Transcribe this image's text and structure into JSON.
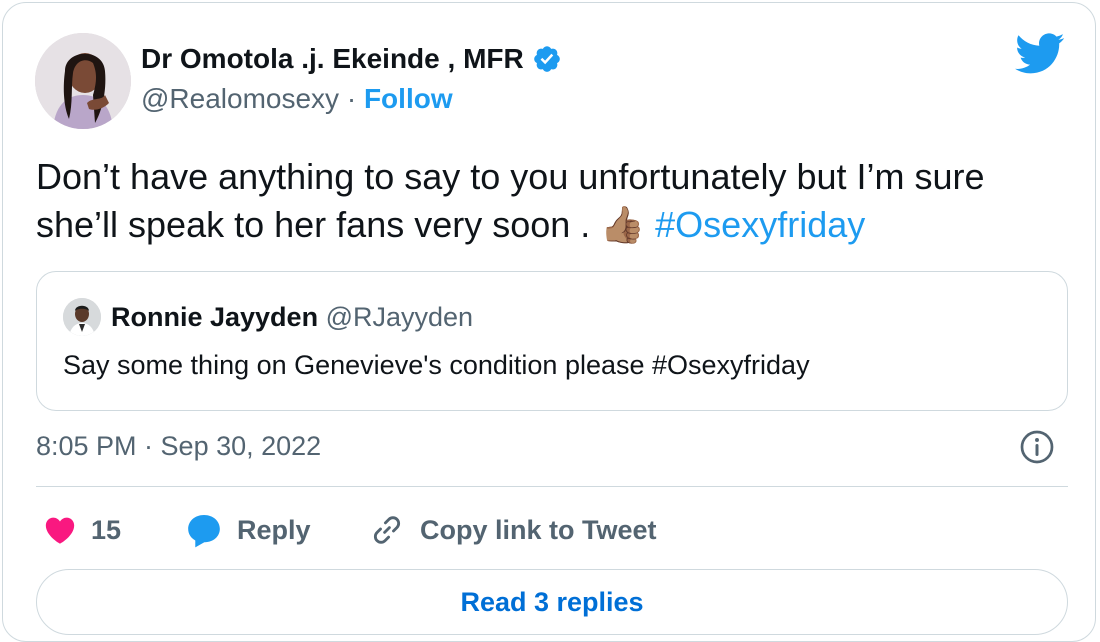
{
  "author": {
    "name": "Dr Omotola .j. Ekeinde , MFR",
    "handle": "@Realomosexy",
    "separator": "·",
    "follow_label": "Follow",
    "verified": true
  },
  "tweet": {
    "text": "Don’t have anything to say to you unfortunately but I’m sure she’ll speak to her fans very soon .",
    "emoji": "👍🏽",
    "hashtag": "#Osexyfriday"
  },
  "quoted_tweet": {
    "name": "Ronnie Jayyden",
    "handle": "@RJayyden",
    "text": "Say some thing on Genevieve's condition please #Osexyfriday"
  },
  "timestamp": "8:05 PM · Sep 30, 2022",
  "actions": {
    "like_count": "15",
    "reply_label": "Reply",
    "copy_label": "Copy link to Tweet"
  },
  "read_replies_label": "Read 3 replies",
  "colors": {
    "accent": "#1d9bf0",
    "like": "#f91880",
    "secondary_text": "#536471",
    "border": "#cfd9de"
  }
}
